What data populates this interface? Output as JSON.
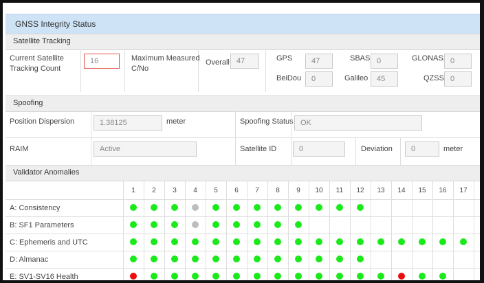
{
  "header": {
    "title": "GNSS Integrity Status"
  },
  "sections": {
    "tracking": "Satellite Tracking",
    "spoofing": "Spoofing",
    "validator": "Validator Anomalies"
  },
  "tracking": {
    "count_label_1": "Current Satellite",
    "count_label_2": "Tracking Count",
    "count_value": "16",
    "cno_label_1": "Maximum Measured",
    "cno_label_2": "C/No",
    "overall_label": "Overall",
    "overall_value": "47",
    "gps_label": "GPS",
    "gps_value": "47",
    "sbas_label": "SBAS",
    "sbas_value": "0",
    "glonass_label": "GLONASS",
    "glonass_value": "0",
    "beidou_label": "BeiDou",
    "beidou_value": "0",
    "galileo_label": "Galileo",
    "galileo_value": "45",
    "qzss_label": "QZSS",
    "qzss_value": "0"
  },
  "spoofing": {
    "dispersion_label": "Position Dispersion",
    "dispersion_value": "1.38125",
    "dispersion_unit": "meter",
    "status_label": "Spoofing Status",
    "status_value": "OK",
    "raim_label": "RAIM",
    "raim_value": "Active",
    "sat_id_label": "Satellite ID",
    "sat_id_value": "0",
    "deviation_label": "Deviation",
    "deviation_value": "0",
    "deviation_unit": "meter"
  },
  "validator": {
    "columns": [
      "1",
      "2",
      "3",
      "4",
      "5",
      "6",
      "7",
      "8",
      "9",
      "10",
      "11",
      "12",
      "13",
      "14",
      "15",
      "16",
      "17"
    ],
    "rows": [
      {
        "label": "A:  Consistency",
        "states": [
          "g",
          "g",
          "g",
          "s",
          "g",
          "g",
          "g",
          "g",
          "g",
          "g",
          "g",
          "g"
        ]
      },
      {
        "label": "B:  SF1 Parameters",
        "states": [
          "g",
          "g",
          "g",
          "s",
          "g",
          "g",
          "g",
          "g",
          "g"
        ]
      },
      {
        "label": "C:  Ephemeris and UTC",
        "states": [
          "g",
          "g",
          "g",
          "g",
          "g",
          "g",
          "g",
          "g",
          "g",
          "g",
          "g",
          "g",
          "g",
          "g",
          "g",
          "g",
          "g"
        ]
      },
      {
        "label": "D:  Almanac",
        "states": [
          "g",
          "g",
          "g",
          "g",
          "g",
          "g",
          "g",
          "g",
          "g",
          "g",
          "g",
          "g"
        ]
      },
      {
        "label": "E:  SV1-SV16 Health",
        "states": [
          "r",
          "g",
          "g",
          "g",
          "g",
          "g",
          "g",
          "g",
          "g",
          "g",
          "g",
          "g",
          "g",
          "r",
          "g",
          "g"
        ]
      }
    ]
  },
  "colors": {
    "ok": "#1aea1a",
    "fail": "#ee0d0d",
    "unknown": "#bdbdbd",
    "header_bg": "#cfe3f6"
  }
}
